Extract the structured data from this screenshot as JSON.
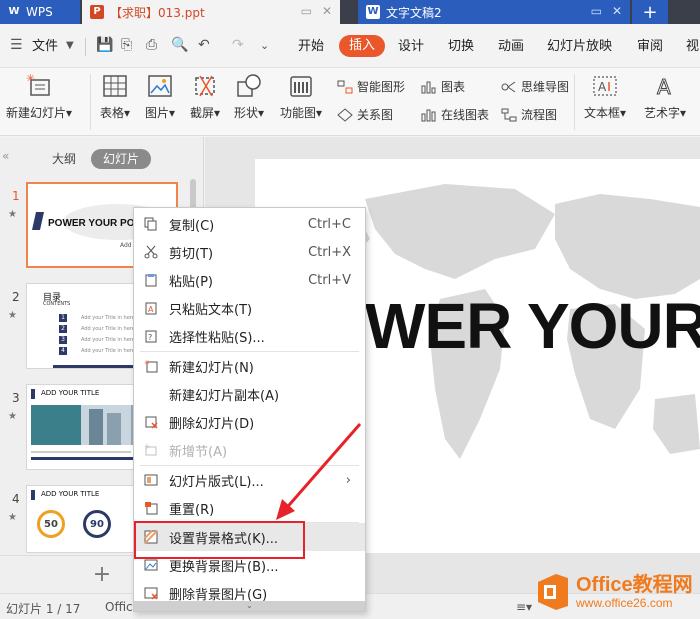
{
  "titlebar": {
    "wps_label": "WPS",
    "ppt_tab": "【求职】013.ppt",
    "doc_tab": "文字文稿2",
    "add_tab": "+"
  },
  "menubar": {
    "file": "文件",
    "items": [
      "开始",
      "插入",
      "设计",
      "切换",
      "动画",
      "幻灯片放映",
      "审阅",
      "视"
    ],
    "active": "插入"
  },
  "ribbon": {
    "new_slide": "新建幻灯片",
    "table": "表格",
    "picture": "图片",
    "screenshot": "截屏",
    "shape": "形状",
    "function_chart": "功能图",
    "smart_shape": "智能图形",
    "chart": "图表",
    "mindmap": "思维导图",
    "relation": "关系图",
    "online_chart": "在线图表",
    "flowchart": "流程图",
    "textbox": "文本框",
    "wordart": "艺术字"
  },
  "left_pane": {
    "tab_outline": "大纲",
    "tab_slides": "幻灯片",
    "slides": [
      {
        "num": "1",
        "title": "POWER YOUR PO",
        "sub": "Add yo"
      },
      {
        "num": "2",
        "title": "目录",
        "sub": "CONTENTS",
        "rows": [
          "Add your Title in here",
          "Add your Title in here",
          "Add your Title in here",
          "Add your Title in here"
        ]
      },
      {
        "num": "3",
        "title": "ADD YOUR TITLE"
      },
      {
        "num": "4",
        "title": "ADD YOUR TITLE",
        "values": [
          "50",
          "90"
        ]
      }
    ]
  },
  "editor": {
    "slide_title": "WER YOUR"
  },
  "context_menu": {
    "items": [
      {
        "label": "复制(C)",
        "shortcut": "Ctrl+C"
      },
      {
        "label": "剪切(T)",
        "shortcut": "Ctrl+X"
      },
      {
        "label": "粘贴(P)",
        "shortcut": "Ctrl+V"
      },
      {
        "label": "只粘贴文本(T)"
      },
      {
        "label": "选择性粘贴(S)..."
      },
      {
        "label": "新建幻灯片(N)"
      },
      {
        "label": "新建幻灯片副本(A)"
      },
      {
        "label": "删除幻灯片(D)"
      },
      {
        "label": "新增节(A)"
      },
      {
        "label": "幻灯片版式(L)...",
        "submenu": "›"
      },
      {
        "label": "重置(R)"
      },
      {
        "label": "设置背景格式(K)..."
      },
      {
        "label": "更换背景图片(B)..."
      },
      {
        "label": "删除背景图片(G)"
      }
    ]
  },
  "statusbar": {
    "slide_count": "幻灯片 1 / 17",
    "theme": "Offic"
  },
  "watermark": {
    "title": "Office教程网",
    "url": "www.office26.com"
  },
  "colors": {
    "accent_orange": "#e9572a",
    "wps_blue": "#2b5dbd",
    "highlight_red": "#e8222a",
    "watermark_orange": "#f07a1e"
  }
}
